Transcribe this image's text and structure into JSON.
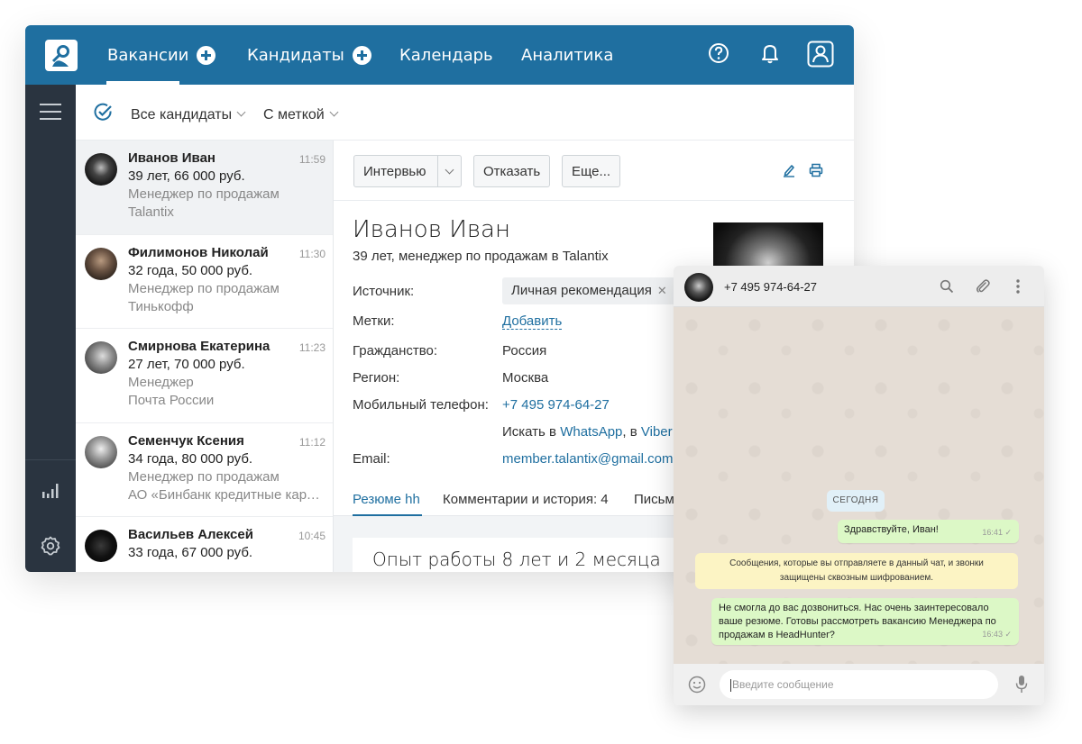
{
  "app": {
    "nav": {
      "vacancies": "Вакансии",
      "candidates": "Кандидаты",
      "calendar": "Календарь",
      "analytics": "Аналитика"
    },
    "filters": {
      "all_candidates": "Все кандидаты",
      "tagged": "С меткой"
    },
    "candidates": [
      {
        "name": "Иванов Иван",
        "time": "11:59",
        "info": "39 лет, 66 000 руб.",
        "position": "Менеджер по продажам",
        "company": "Talantix",
        "avatar_color": "#1a1a1a"
      },
      {
        "name": "Филимонов Николай",
        "time": "11:30",
        "info": "32 года, 50 000 руб.",
        "position": "Менеджер по продажам",
        "company": "Тинькофф",
        "avatar_color": "#5a4a3e"
      },
      {
        "name": "Смирнова Екатерина",
        "time": "11:23",
        "info": "27 лет, 70 000 руб.",
        "position": "Менеджер",
        "company": "Почта России",
        "avatar_color": "#8a8a8a"
      },
      {
        "name": "Семенчук Ксения",
        "time": "11:12",
        "info": "34 года, 80 000 руб.",
        "position": "Менеджер по продажам",
        "company": "АО «Бинбанк кредитные карты»",
        "avatar_color": "#9a9a9a"
      },
      {
        "name": "Васильев Алексей",
        "time": "10:45",
        "info": "33 года, 67 000 руб.",
        "position": "",
        "company": "",
        "avatar_color": "#0d0d0d"
      }
    ],
    "actions": {
      "interview": "Интервью",
      "reject": "Отказать",
      "more": "Еще..."
    },
    "detail": {
      "name": "Иванов Иван",
      "subtitle": "39 лет, менеджер по продажам в Talantix",
      "source_label": "Источник:",
      "source_value": "Личная рекомендация",
      "tags_label": "Метки:",
      "tags_add": "Добавить",
      "citizenship_label": "Гражданство:",
      "citizenship_value": "Россия",
      "region_label": "Регион:",
      "region_value": "Москва",
      "phone_label": "Мобильный телефон:",
      "phone_value": "+7 495 974-64-27",
      "search_prefix": "Искать в ",
      "search_whatsapp": "WhatsApp",
      "search_mid": ", в ",
      "search_viber": "Viber",
      "email_label": "Email:",
      "email_value": "member.talantix@gmail.com"
    },
    "tabs": {
      "resume": "Резюме hh",
      "comments": "Комментарии и история: 4",
      "letters": "Письма"
    },
    "resume_title": "Опыт работы 8 лет и 2 месяца"
  },
  "whatsapp": {
    "phone": "+7 495 974-64-27",
    "date_label": "СЕГОДНЯ",
    "messages": [
      {
        "text": "Здравствуйте, Иван!",
        "time": "16:41 ✓"
      },
      {
        "text": "Не смогла до вас дозвониться. Нас очень заинтересовало ваше резюме. Готовы рассмотреть вакансию Менеджера по продажам в HeadHunter?",
        "time": "16:43 ✓"
      }
    ],
    "system_line1": "Сообщения, которые вы отправляете в данный чат, и звонки",
    "system_line2": "защищены сквозным шифрованием.",
    "input_placeholder": "Введите сообщение"
  },
  "colors": {
    "brand": "#1f6fa0",
    "sidebar": "#2a3440",
    "bubble": "#dcf8c6",
    "system_bubble": "#fcf4c4"
  }
}
